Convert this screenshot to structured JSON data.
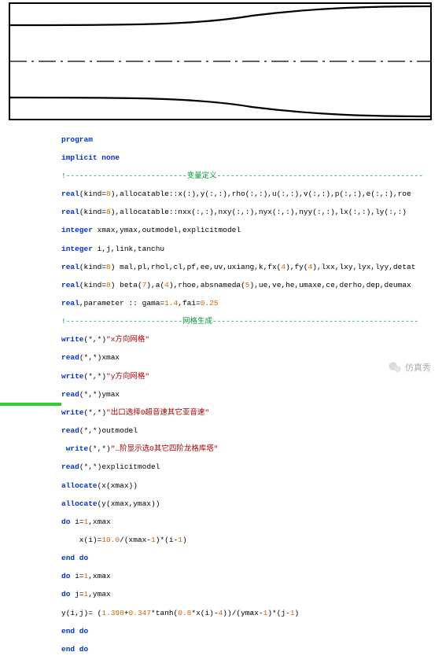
{
  "section_labels": {
    "vardef": "变量定义",
    "meshgen": "网格生成"
  },
  "code": {
    "l1": "program",
    "l2": "implicit none",
    "l3_a": "real",
    "l3_b": "(kind=",
    "l3_c": "8",
    "l3_d": "),allocatable::x(:),y(:,:),rho(:,:),u(:,:),v(:,:),p(:,:),e(:,:),roe",
    "l4_a": "real",
    "l4_b": "(kind=",
    "l4_c": "8",
    "l4_d": "),allocatable::nxx(:,:),nxy(:,:),nyx(:,:),nyy(:,:),lx(:,:),ly(:,:)",
    "l5_a": "integer",
    "l5_b": " xmax,ymax,outmodel,explicitmodel",
    "l6_a": "integer",
    "l6_b": " i,j,link,tanchu",
    "l7_a": "real",
    "l7_b": "(kind=",
    "l7_c": "8",
    "l7_d": ") mal,pl,rhol,cl,pf,ee,uv,uxiang,k,fx(",
    "l7_e": "4",
    "l7_f": "),fy(",
    "l7_g": "4",
    "l7_h": "),lxx,lxy,lyx,lyy,detat",
    "l8_a": "real",
    "l8_b": "(kind=",
    "l8_c": "8",
    "l8_d": ") beta(",
    "l8_e": "7",
    "l8_f": "),a(",
    "l8_g": "4",
    "l8_h": "),rhoe,absnameda(",
    "l8_i": "5",
    "l8_j": "),ue,ve,he,umaxe,ce,derho,dep,deumax",
    "l9_a": "real",
    "l9_b": ",parameter :: gama=",
    "l9_c": "1.4",
    "l9_d": ",fai=",
    "l9_e": "0.25",
    "l10_a": "write",
    "l10_b": "(*,*)",
    "l10_c": "\"x方向网格\"",
    "l11_a": "read",
    "l11_b": "(*,*)xmax",
    "l12_a": "write",
    "l12_b": "(*,*)",
    "l12_c": "\"y方向网格\"",
    "l13_a": "read",
    "l13_b": "(*,*)ymax",
    "l14_a": "write",
    "l14_b": "(*,*)",
    "l14_c": "\"出口选择0超音速其它亚音速\"",
    "l15_a": "read",
    "l15_b": "(*,*)outmodel",
    "l16_a": " write",
    "l16_b": "(*,*)",
    "l16_c": "\"…阶显示选0其它四阶龙格库塔\"",
    "l17_a": "read",
    "l17_b": "(*,*)explicitmodel",
    "l18_a": "allocate",
    "l18_b": "(x(xmax))",
    "l19_a": "allocate",
    "l19_b": "(y(xmax,ymax))",
    "l20_a": "do",
    "l20_b": " i=",
    "l20_c": "1",
    "l20_d": ",xmax",
    "l21_a": "    x(i)=",
    "l21_b": "10.0",
    "l21_c": "/(xmax-",
    "l21_d": "1",
    "l21_e": ")*(i-",
    "l21_f": "1",
    "l21_g": ")",
    "l22": "end do",
    "l23_a": "do",
    "l23_b": " i=",
    "l23_c": "1",
    "l23_d": ",xmax",
    "l24_a": "do",
    "l24_b": " j=",
    "l24_c": "1",
    "l24_d": ",ymax",
    "l25_a": "y(i,j)= (",
    "l25_b": "1.398",
    "l25_c": "+",
    "l25_d": "0.347",
    "l25_e": "*tanh(",
    "l25_f": "0.8",
    "l25_g": "*x(i)-",
    "l25_h": "4",
    "l25_i": "))/(ymax-",
    "l25_j": "1",
    "l25_k": ")*(j-",
    "l25_l": "1",
    "l25_m": ")",
    "l26": "end do",
    "l27": "end do"
  },
  "watermark": "仿真秀"
}
